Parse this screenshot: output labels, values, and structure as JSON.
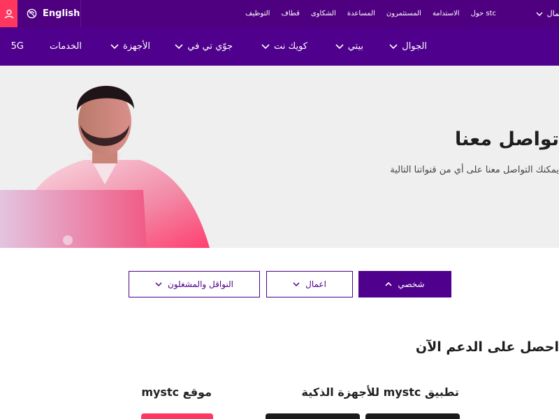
{
  "topbar": {
    "lang_label": "English",
    "links": [
      "حول stc",
      "الاستدامة",
      "المستثمرون",
      "المساعدة",
      "الشكاوى",
      "قطاف",
      "التوظيف"
    ],
    "business_label": "أعمال"
  },
  "nav": {
    "items": [
      "الجوال",
      "بيتي",
      "كويك نت",
      "جوّي تي في",
      "الأجهزة",
      "الخدمات",
      "5G"
    ]
  },
  "hero": {
    "title": "تواصل معنا",
    "subtitle": "يمكنك التواصل معنا على أي من قنواتنا التالية"
  },
  "filters": {
    "personal": "شخصي",
    "business": "اعمال",
    "carriers": "النواقل والمشغلون"
  },
  "support": {
    "heading": "احصل على الدعم الآن",
    "app_title": "تطبيق mystc للأجهزة الذكية",
    "site_title": "موقع mystc"
  },
  "colors": {
    "brand_purple": "#4f008c",
    "accent_coral": "#ff375e"
  }
}
